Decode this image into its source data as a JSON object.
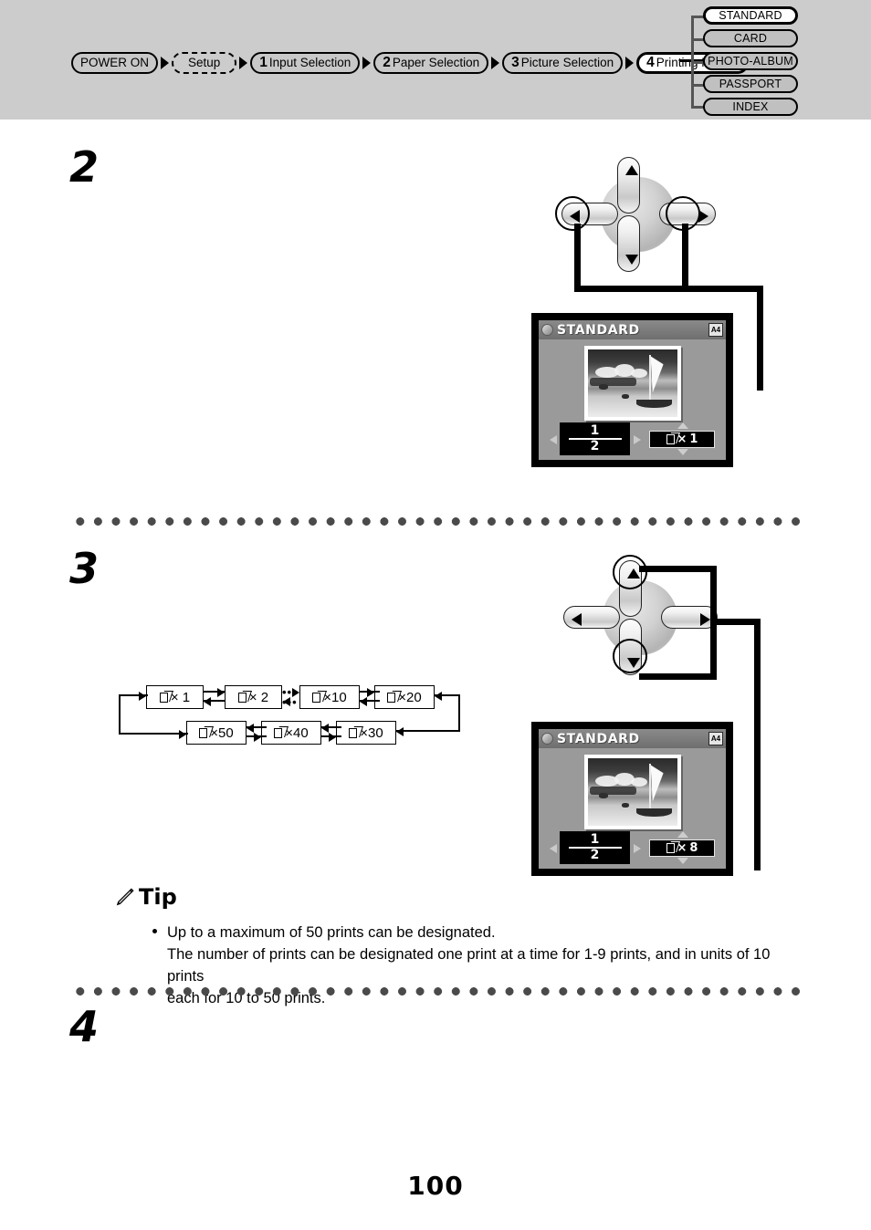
{
  "nav": {
    "breadcrumb": [
      {
        "label": "POWER ON",
        "num": "",
        "style": "solid"
      },
      {
        "label": "Setup",
        "num": "",
        "style": "dashed"
      },
      {
        "label": "Input Selection",
        "num": "1",
        "style": "solid"
      },
      {
        "label": "Paper Selection",
        "num": "2",
        "style": "solid"
      },
      {
        "label": "Picture Selection",
        "num": "3",
        "style": "solid"
      },
      {
        "label": "Printing Modes",
        "num": "4",
        "style": "active"
      }
    ],
    "modes": [
      {
        "label": "STANDARD",
        "selected": true
      },
      {
        "label": "CARD",
        "selected": false
      },
      {
        "label": "PHOTO-ALBUM",
        "selected": false
      },
      {
        "label": "PASSPORT",
        "selected": false
      },
      {
        "label": "INDEX",
        "selected": false
      }
    ]
  },
  "steps": {
    "two": "2",
    "three": "3",
    "four": "4"
  },
  "lcd_top": {
    "title": "STANDARD",
    "paper_badge": "A4",
    "page_current": "1",
    "page_total": "2",
    "count_multiplier": "×",
    "count_value": "1"
  },
  "lcd_bottom": {
    "title": "STANDARD",
    "paper_badge": "A4",
    "page_current": "1",
    "page_total": "2",
    "count_multiplier": "×",
    "count_value": "8"
  },
  "flow": {
    "row_top": [
      "× 1",
      "× 2",
      "×10",
      "×20"
    ],
    "row_bottom": [
      "×50",
      "×40",
      "×30"
    ],
    "ellipsis": "•••"
  },
  "tip": {
    "heading": "Tip",
    "line1": "Up to a maximum of 50 prints can be designated.",
    "line2": "The number of prints can be designated one print at a time for 1-9 prints, and in units of 10 prints",
    "line3": "each for 10 to 50 prints."
  },
  "footer": {
    "page_number": "100"
  },
  "colors": {
    "band": "#cccccc",
    "crumb": "#c8c8c8",
    "mode": "#c0c0c0",
    "lcd_bezel": "#000000",
    "lcd_bg": "#9a9a9a",
    "dot": "#4a4a4a"
  }
}
